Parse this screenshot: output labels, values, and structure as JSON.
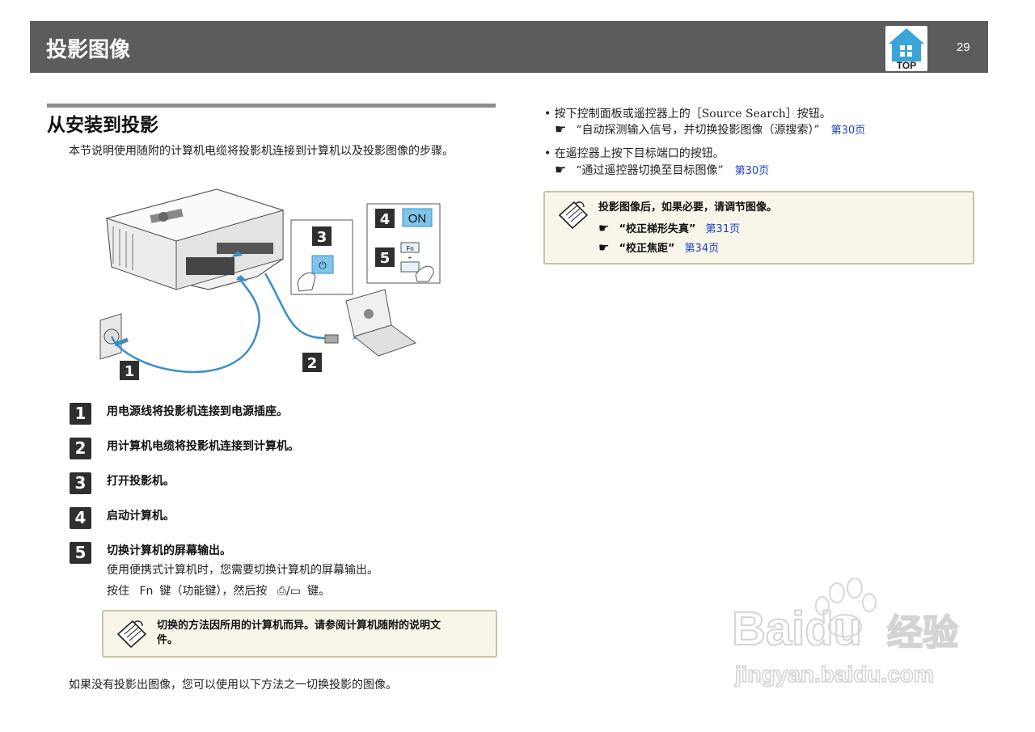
{
  "header": {
    "title": "投影图像",
    "top_button_label": "TOP",
    "page_number": "29"
  },
  "section": {
    "title": "从安装到投影",
    "intro": "本节说明使用随附的计算机电缆将投影机连接到计算机以及投影图像的步骤。"
  },
  "illustration": {
    "callouts": [
      "1",
      "2",
      "3",
      "4",
      "5"
    ],
    "on_label": "ON",
    "fn_label": "Fn",
    "plus_label": "+"
  },
  "steps": [
    {
      "num": "1",
      "text": "用电源线将投影机连接到电源插座。"
    },
    {
      "num": "2",
      "text": "用计算机电缆将投影机连接到计算机。"
    },
    {
      "num": "3",
      "text": "打开投影机。"
    },
    {
      "num": "4",
      "text": "启动计算机。"
    },
    {
      "num": "5",
      "text": "切换计算机的屏幕输出。"
    }
  ],
  "step5_detail": {
    "line1": "使用便携式计算机时，您需要切换计算机的屏幕输出。",
    "line2_pre": "按住",
    "fn_key": "Fn",
    "line2_mid": "键（功能键），然后按",
    "display_key": "⎙/▭",
    "line2_post": "键。"
  },
  "note_left": {
    "line1": "切换的方法因所用的计算机而异。请参阅计算机随附的说明文",
    "line2": "件。"
  },
  "bottom_text": "如果没有投影出图像，您可以使用以下方法之一切换投影的图像。",
  "right": {
    "bullet1": "按下控制面板或遥控器上的［Source Search］按钮。",
    "ref1_text": "“自动探测输入信号，并切换投影图像（源搜索）”",
    "ref1_link": "第30页",
    "bullet2": "在遥控器上按下目标端口的按钮。",
    "ref2_text": "“通过遥控器切换至目标图像”",
    "ref2_link": "第30页",
    "hand": "☛",
    "bullet_dot": "•"
  },
  "note_right": {
    "text": "投影图像后，如果必要，请调节图像。",
    "refs": [
      {
        "text": "“校正梯形失真”",
        "link": "第31页"
      },
      {
        "text": "“校正焦距”",
        "link": "第34页"
      }
    ]
  },
  "watermark": {
    "brand": "Baidu",
    "brand_cn": "经验",
    "url": "jingyan.baidu.com"
  },
  "colors": {
    "header_bg": "#5c5c5c",
    "link": "#1a3fcc",
    "note_bg": "#f8f6e8",
    "top_icon": "#3ba4d8"
  }
}
